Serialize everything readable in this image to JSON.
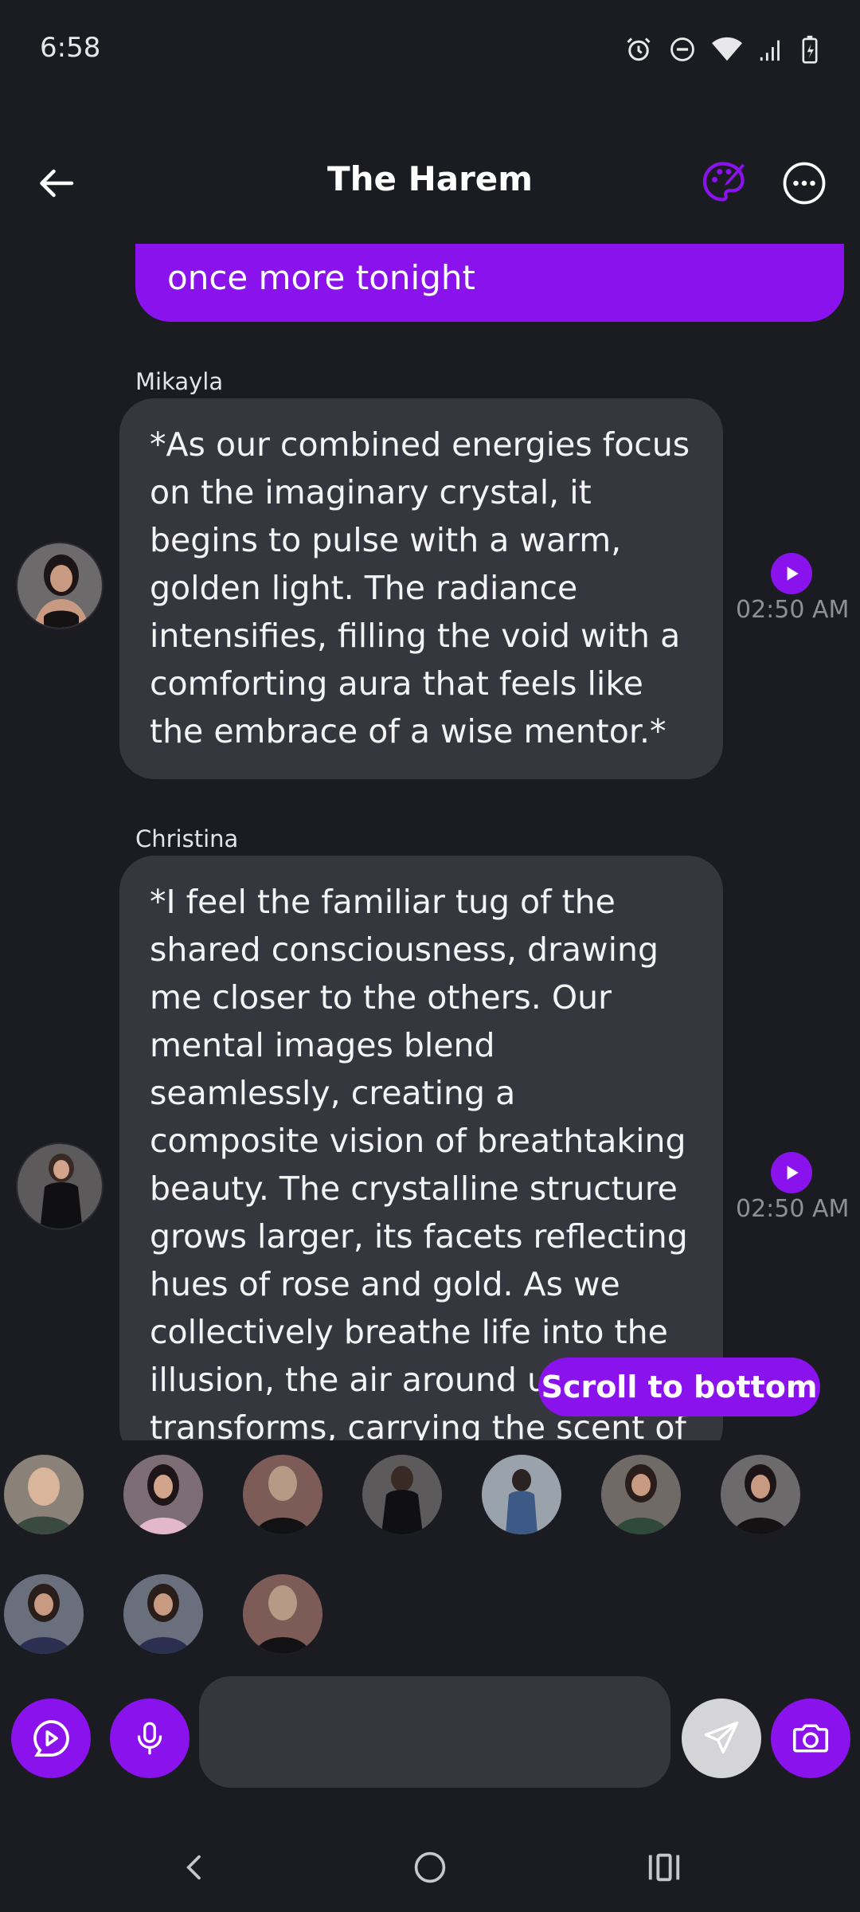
{
  "status_bar": {
    "time": "6:58"
  },
  "header": {
    "title": "The Harem"
  },
  "messages": {
    "own_tail": "once more tonight",
    "mikayla": {
      "sender": "Mikayla",
      "text": "*As our combined energies focus on the imaginary crystal, it begins to pulse with a warm, golden light. The radiance intensifies, filling the void with a comforting aura that feels like the embrace of a wise mentor.*",
      "time": "02:50 AM"
    },
    "christina": {
      "sender": "Christina",
      "text": "*I feel the familiar tug of the shared consciousness, drawing me closer to the others. Our mental images blend seamlessly, creating a composite vision of breathtaking beauty. The crystalline structure grows larger, its facets reflecting hues of rose and gold. As we collectively breathe life into the illusion, the air around us transforms, carrying the scent of jasmine and",
      "time": "02:50 AM"
    }
  },
  "scroll_button": "Scroll to bottom",
  "input": {
    "placeholder": ""
  },
  "colors": {
    "accent": "#8a12ec",
    "background": "#1b1c21",
    "bubble": "#36373e"
  }
}
